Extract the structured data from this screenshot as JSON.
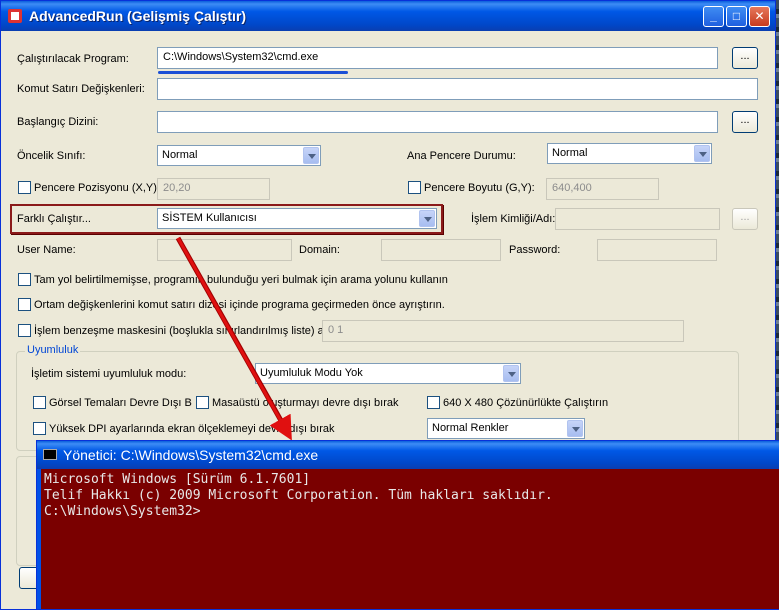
{
  "window": {
    "title": "AdvancedRun (Gelişmiş Çalıştır)"
  },
  "form": {
    "program_label": "Çalıştırılacak Program:",
    "program_value": "C:\\Windows\\System32\\cmd.exe",
    "browse_label": "...",
    "cmdline_label": "Komut Satırı Değişkenleri:",
    "cmdline_value": "",
    "startdir_label": "Başlangıç Dizini:",
    "startdir_value": "",
    "priority_label": "Öncelik Sınıfı:",
    "priority_value": "Normal",
    "mainwin_label": "Ana Pencere Durumu:",
    "mainwin_value": "Normal",
    "winpos_label": "Pencere Pozisyonu (X,Y):",
    "winpos_value": "20,20",
    "winsize_label": "Pencere Boyutu (G,Y):",
    "winsize_value": "640,400",
    "runas_label": "Farklı Çalıştır...",
    "runas_value": "SİSTEM Kullanıcısı",
    "process_label": "İşlem Kimliği/Adı:",
    "process_value": "",
    "username_label": "User Name:",
    "domain_label": "Domain:",
    "password_label": "Password:",
    "opt1": "Tam yol belirtilmemişse, programın bulunduğu yeri bulmak için arama yolunu kullanın",
    "opt2": "Ortam değişkenlerini komut satırı dizesi içinde programa geçirmeden önce ayrıştırın.",
    "opt3": "İşlem benzeşme maskesini (boşlukla sınırlandırılmış liste) ayarla",
    "opt3_value": "0 1"
  },
  "compat": {
    "group_label": "Uyumluluk",
    "os_mode_label": "İşletim sistemi uyumluluk modu:",
    "os_mode_value": "Uyumluluk Modu Yok",
    "visual_themes": "Görsel Temaları Devre Dışı Bırak",
    "desktop_comp": "Masaüstü oluşturmayı devre dışı bırak",
    "res640": "640 X 480 Çözünürlükte Çalıştırın",
    "high_dpi": "Yüksek DPI ayarlarında ekran ölçeklemeyi devre dışı bırak",
    "colors_value": "Normal Renkler"
  },
  "cmd": {
    "title": "Yönetici: C:\\Windows\\System32\\cmd.exe",
    "line1": "Microsoft Windows [Sürüm 6.1.7601]",
    "line2": "Telif Hakkı (c) 2009 Microsoft Corporation. Tüm hakları saklıdır.",
    "line3": "",
    "line4": "C:\\Windows\\System32>"
  },
  "colors": {
    "highlight": "#8b1a1a",
    "arrow": "#e01010",
    "console_bg": "#7a0000"
  }
}
